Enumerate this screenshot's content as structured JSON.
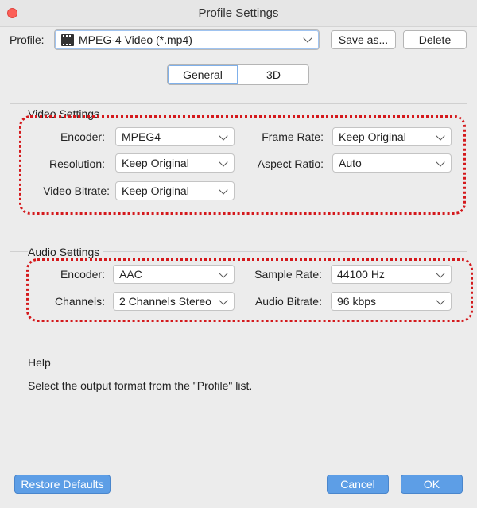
{
  "window": {
    "title": "Profile Settings"
  },
  "profile": {
    "label": "Profile:",
    "value": "MPEG-4 Video (*.mp4)"
  },
  "toolbar": {
    "save_as_label": "Save as...",
    "delete_label": "Delete"
  },
  "tabs": [
    {
      "label": "General",
      "selected": true
    },
    {
      "label": "3D",
      "selected": false
    }
  ],
  "video": {
    "title": "Video Settings",
    "encoder_label": "Encoder:",
    "encoder_value": "MPEG4",
    "frame_rate_label": "Frame Rate:",
    "frame_rate_value": "Keep Original",
    "resolution_label": "Resolution:",
    "resolution_value": "Keep Original",
    "aspect_ratio_label": "Aspect Ratio:",
    "aspect_ratio_value": "Auto",
    "bitrate_label": "Video Bitrate:",
    "bitrate_value": "Keep Original"
  },
  "audio": {
    "title": "Audio Settings",
    "encoder_label": "Encoder:",
    "encoder_value": "AAC",
    "sample_rate_label": "Sample Rate:",
    "sample_rate_value": "44100 Hz",
    "channels_label": "Channels:",
    "channels_value": "2 Channels Stereo",
    "bitrate_label": "Audio Bitrate:",
    "bitrate_value": "96 kbps"
  },
  "help": {
    "title": "Help",
    "text": "Select the output format from the \"Profile\" list."
  },
  "footer": {
    "restore_label": "Restore Defaults",
    "cancel_label": "Cancel",
    "ok_label": "OK"
  },
  "colors": {
    "accent": "#5d9ee6",
    "highlight": "#d4191c",
    "close": "#fc5f57"
  },
  "icons": {
    "close": "close-dot-icon",
    "profile": "film-icon",
    "dropdown": "chevron-down-icon"
  }
}
